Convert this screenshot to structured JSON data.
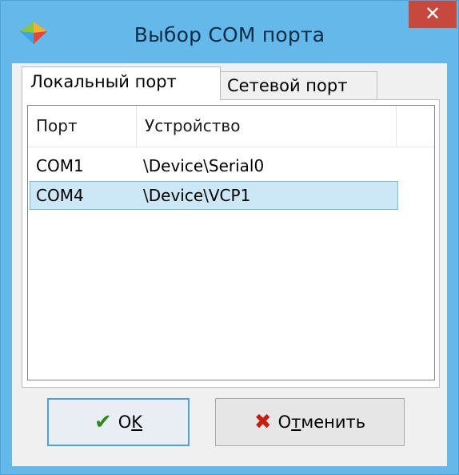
{
  "window": {
    "title": "Выбор COM порта",
    "close_glyph": "✕",
    "icon": "app-icon-colorful-diamond"
  },
  "tabs": [
    {
      "label": "Локальный порт",
      "active": true
    },
    {
      "label": "Сетевой порт",
      "active": false
    }
  ],
  "list": {
    "columns": [
      "Порт",
      "Устройство"
    ],
    "rows": [
      {
        "port": "COM1",
        "device": "\\Device\\Serial0",
        "selected": false
      },
      {
        "port": "COM4",
        "device": "\\Device\\VCP1",
        "selected": true
      }
    ]
  },
  "buttons": {
    "ok": {
      "pre": "O",
      "underlined": "K",
      "post": "",
      "icon": "checkmark-icon"
    },
    "cancel": {
      "pre": "О",
      "underlined": "т",
      "post": "менить",
      "icon": "cross-icon"
    }
  },
  "colors": {
    "titlebar": "#65b9ea",
    "close": "#c7483c",
    "selection": "#cce8f6",
    "check": "#2e8b1c",
    "cross": "#c81e0f"
  }
}
